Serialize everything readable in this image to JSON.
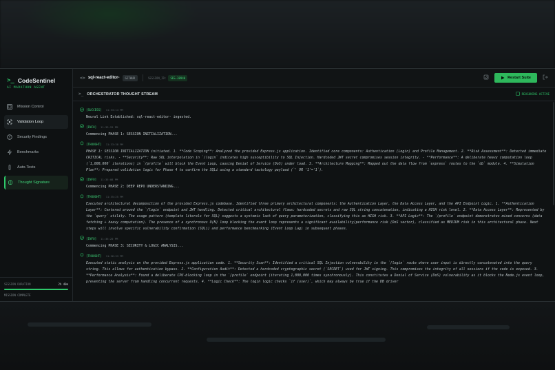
{
  "sidebar": {
    "brand_name": "CodeSentinel",
    "brand_subtitle": "AI MARATHON AGENT",
    "items": [
      {
        "label": "Mission Control",
        "icon": "dashboard-icon"
      },
      {
        "label": "Validation Loop",
        "icon": "loop-icon"
      },
      {
        "label": "Security Findings",
        "icon": "shield-icon"
      },
      {
        "label": "Benchmarks",
        "icon": "bolt-icon"
      },
      {
        "label": "Auto-Tests",
        "icon": "test-tube-icon"
      },
      {
        "label": "Thought Signature",
        "icon": "brain-icon"
      }
    ],
    "footer": {
      "duration_label": "SESSION DURATION",
      "duration_value": "2h 40m",
      "progress": 1.0,
      "status": "MISSION COMPLETE"
    }
  },
  "topbar": {
    "repo_name": "sql-react-editor-",
    "source_tag": "GITHUB",
    "session_label": "SESSION_ID:",
    "session_id": "SES-38940",
    "restart_label": "Restart Suite"
  },
  "stream": {
    "title": "ORCHESTRATOR THOUGHT STREAM",
    "status": "REASONING ACTIVE",
    "entries": [
      {
        "tag": "[SUCCESS]",
        "time": "11:33:14 PM",
        "kind": "success",
        "text": "Neural Link Established: sql-react-editor- ingested."
      },
      {
        "tag": "[INFO]",
        "time": "11:33:29 PM",
        "kind": "info",
        "text": "Commencing PHASE 1: SESSION INITIALIZATION..."
      },
      {
        "tag": "[THOUGHT]",
        "time": "11:33:38 PM",
        "kind": "thought",
        "text": "PHASE 1: SESSION INITIALIZATION initiated. 1. **Code Scoping**: Analyzed the provided Express.js application. Identified core components: Authentication (Login) and Profile Management. 2. **Risk Assessment**: Detected immediate CRITICAL risks. - **Security**: Raw SQL interpolation in `/login` indicates high susceptibility to SQL Injection. Hardcoded JWT secret compromises session integrity. - **Performance**: A deliberate heavy computation loop (`1,000,000` iterations) in `/profile` will block the Event Loop, causing Denial of Service (DoS) under load. 3. **Architecture Mapping**: Mapped out the data flow from `express` routes to the `db` module. 4. **Simulation Plan**: Prepared validation logic for Phase 4 to confirm the SQLi using a standard tautology payload (`' OR '1'='1`)."
      },
      {
        "tag": "[INFO]",
        "time": "11:35:08 PM",
        "kind": "info",
        "text": "Commencing PHASE 2: DEEP REPO UNDERSTANDING..."
      },
      {
        "tag": "[THOUGHT]",
        "time": "11:35:25 PM",
        "kind": "thought",
        "text": "Executed architectural decomposition of the provided Express.js codebase. Identified three primary architectural components: the Authentication Layer, the Data Access Layer, and the API Endpoint Logic. 1. **Authentication Layer**: Centered around the `/login` endpoint and JWT handling. Detected critical architectural flaws: hardcoded secrets and raw SQL string concatenation, indicating a HIGH risk level. 2. **Data Access Layer**: Represented by the `query` utility. The usage pattern (template literals for SQL) suggests a systemic lack of query parameterization, classifying this as HIGH risk. 3. **API Logic**: The `/profile` endpoint demonstrates mixed concerns (data fetching + heavy computation). The presence of a synchronous O(N) loop blocking the event loop represents a significant availability/performance risk (DoS vector), classified as MEDIUM risk in this architectural phase. Next steps will involve specific vulnerability confirmation (SQLi) and performance benchmarking (Event Loop Lag) in subsequent phases."
      },
      {
        "tag": "[INFO]",
        "time": "11:36:20 PM",
        "kind": "info",
        "text": "Commencing PHASE 3: SECURITY & LOGIC ANALYSIS..."
      },
      {
        "tag": "[THOUGHT]",
        "time": "11:36:33 PM",
        "kind": "thought",
        "text": "Executed static analysis on the provided Express.js application code. 1. **Security Scan**: Identified a critical SQL Injection vulnerability in the `/login` route where user input is directly concatenated into the query string. This allows for authentication bypass. 2. **Configuration Audit**: Detected a hardcoded cryptographic secret (`SECRET`) used for JWT signing. This compromises the integrity of all sessions if the code is exposed. 3. **Performance Analysis**: Found a deliberate CPU-blocking loop in the `/profile` endpoint (iterating 1,000,000 times synchronously). This constitutes a Denial of Service (DoS) vulnerability as it blocks the Node.js event loop, preventing the server from handling concurrent requests. 4. **Logic Check**: The login logic checks `if (user)`, which may always be true if the DB driver"
      }
    ]
  },
  "colors": {
    "accent": "#2ec86a",
    "background": "#0f1213",
    "text": "#c9d1d4"
  }
}
